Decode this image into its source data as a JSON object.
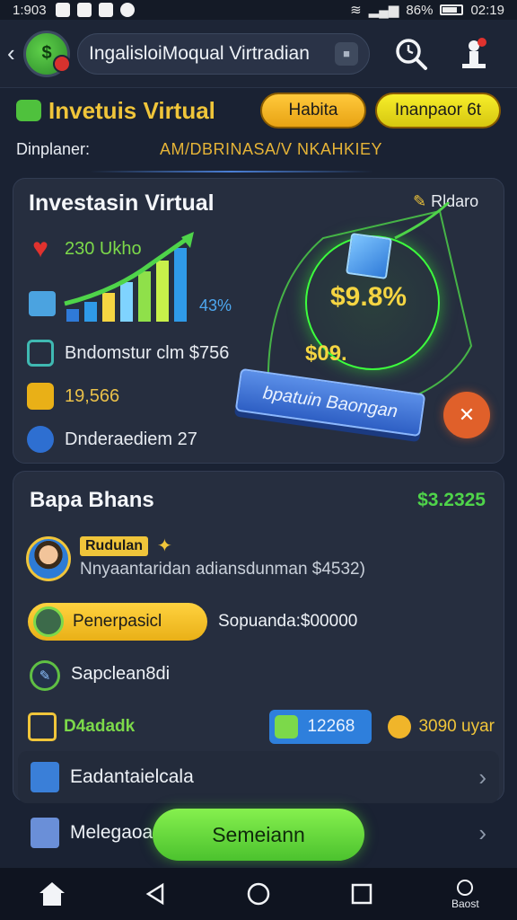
{
  "status_bar": {
    "time": "1:903",
    "battery": "86%",
    "clock": "02:19"
  },
  "top_bar": {
    "search_text": "IngalisloiMoqual Virtradian",
    "back_icon": "chevron-left-icon",
    "lock_icon": "lock-icon",
    "history_icon": "clock-search-icon",
    "profile_icon": "person-icon"
  },
  "header": {
    "title": "Invetuis Virtual",
    "button1": "Habita",
    "button2": "Inanpaor 6t",
    "row_label": "Dinplaner:",
    "row_value": "AM/DBRINASA/V NKAHKIEY"
  },
  "investment_card": {
    "title": "Investasin Virtual",
    "tag": "Rldaro",
    "stat1": "230 Ukho",
    "chart_pct": "43%",
    "stat2": "Bndomstur clm $756",
    "stat3": "19,566",
    "stat4": "Dnderaediem 27",
    "coin_value": "$9.8%",
    "coin_small": "$09.",
    "cta_label": "bpatuin Baongan"
  },
  "balance_card": {
    "title": "Bapa Bhans",
    "amount": "$3.2325",
    "user_name": "Rudulan",
    "description": "Nnyaantaridan adiansdunman $4532)",
    "yellow_button": "Penerpasicl",
    "sub_text": "Sopuanda:$00000",
    "row2_label": "Sapclean8di",
    "bottom_label": "D4adadk",
    "blue_pill_value": "12268",
    "coin_text": "3090 uyar"
  },
  "list": {
    "row1": "Eadantaielcala",
    "row2": "Melegaoa"
  },
  "main_cta": "Semeiann",
  "nav": {
    "back_label": "Baost"
  },
  "colors": {
    "accent_green": "#4cc22e",
    "accent_yellow": "#f0c53a",
    "background": "#1a2233"
  }
}
